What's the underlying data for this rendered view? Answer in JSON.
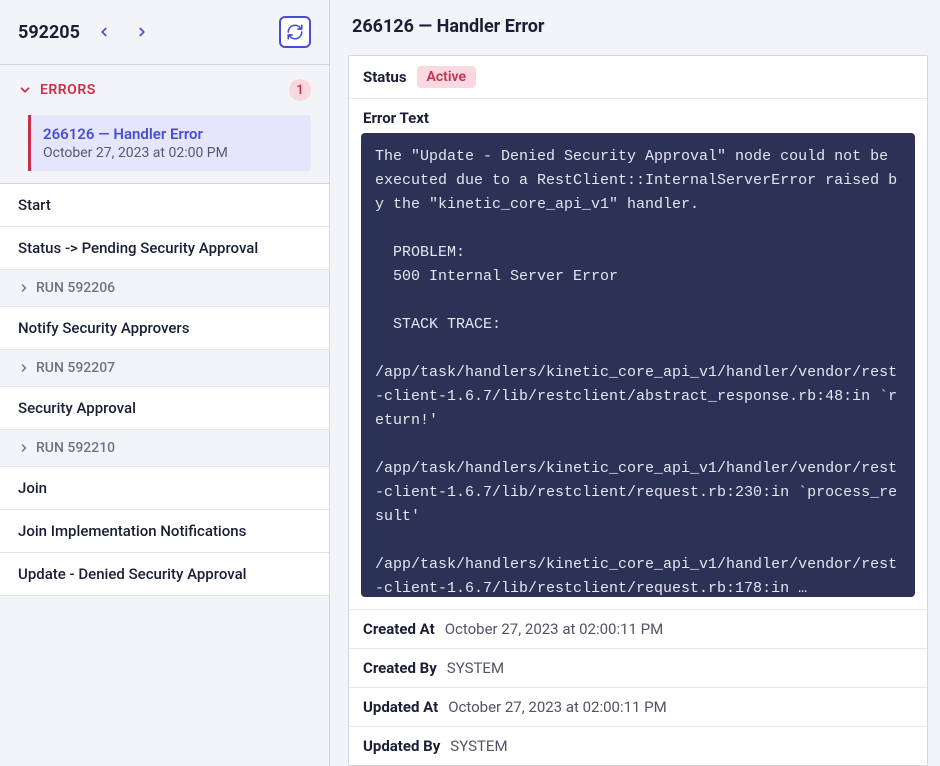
{
  "sidebar": {
    "run_id": "592205",
    "errors_label": "ERRORS",
    "errors_count": "1",
    "error_item": {
      "title": "266126 — Handler Error",
      "date": "October 27, 2023 at 02:00 PM"
    },
    "nodes": [
      {
        "label": "Start"
      },
      {
        "label": "Status -> Pending Security Approval"
      },
      {
        "run": "RUN 592206"
      },
      {
        "label": "Notify Security Approvers"
      },
      {
        "run": "RUN 592207"
      },
      {
        "label": "Security Approval"
      },
      {
        "run": "RUN 592210"
      },
      {
        "label": "Join"
      },
      {
        "label": "Join Implementation Notifications"
      },
      {
        "label": "Update - Denied Security Approval"
      }
    ]
  },
  "main": {
    "title": "266126 — Handler Error",
    "status_label": "Status",
    "status_value": "Active",
    "error_text_label": "Error Text",
    "error_text": "The \"Update - Denied Security Approval\" node could not be executed due to a RestClient::InternalServerError raised by the \"kinetic_core_api_v1\" handler.\n\n  PROBLEM:\n  500 Internal Server Error\n\n  STACK TRACE:\n\n/app/task/handlers/kinetic_core_api_v1/handler/vendor/rest-client-1.6.7/lib/restclient/abstract_response.rb:48:in `return!'\n\n/app/task/handlers/kinetic_core_api_v1/handler/vendor/rest-client-1.6.7/lib/restclient/request.rb:230:in `process_result'\n\n/app/task/handlers/kinetic_core_api_v1/handler/vendor/rest-client-1.6.7/lib/restclient/request.rb:178:in …",
    "created_at_label": "Created At",
    "created_at_value": "October 27, 2023 at 02:00:11 PM",
    "created_by_label": "Created By",
    "created_by_value": "SYSTEM",
    "updated_at_label": "Updated At",
    "updated_at_value": "October 27, 2023 at 02:00:11 PM",
    "updated_by_label": "Updated By",
    "updated_by_value": "SYSTEM"
  }
}
